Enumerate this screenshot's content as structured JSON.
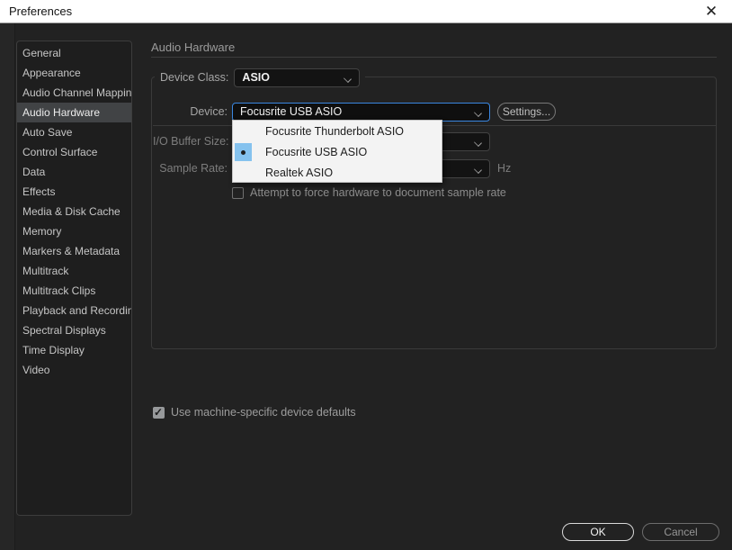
{
  "window": {
    "title": "Preferences",
    "close_glyph": "✕"
  },
  "sidebar": {
    "items": [
      {
        "label": "General",
        "selected": false
      },
      {
        "label": "Appearance",
        "selected": false
      },
      {
        "label": "Audio Channel Mapping",
        "selected": false
      },
      {
        "label": "Audio Hardware",
        "selected": true
      },
      {
        "label": "Auto Save",
        "selected": false
      },
      {
        "label": "Control Surface",
        "selected": false
      },
      {
        "label": "Data",
        "selected": false
      },
      {
        "label": "Effects",
        "selected": false
      },
      {
        "label": "Media & Disk Cache",
        "selected": false
      },
      {
        "label": "Memory",
        "selected": false
      },
      {
        "label": "Markers & Metadata",
        "selected": false
      },
      {
        "label": "Multitrack",
        "selected": false
      },
      {
        "label": "Multitrack Clips",
        "selected": false
      },
      {
        "label": "Playback and Recording",
        "selected": false
      },
      {
        "label": "Spectral Displays",
        "selected": false
      },
      {
        "label": "Time Display",
        "selected": false
      },
      {
        "label": "Video",
        "selected": false
      }
    ]
  },
  "main": {
    "header": "Audio Hardware",
    "device_class": {
      "label": "Device Class:",
      "value": "ASIO"
    },
    "device": {
      "label": "Device:",
      "value": "Focusrite USB ASIO",
      "settings_label": "Settings..."
    },
    "io_buffer": {
      "label": "I/O Buffer Size:",
      "value": ""
    },
    "sample_rate": {
      "label": "Sample Rate:",
      "value": "",
      "unit": "Hz"
    },
    "force_checkbox": {
      "label": "Attempt to force hardware to document sample rate",
      "checked": false
    },
    "machine_defaults_checkbox": {
      "label": "Use machine-specific device defaults",
      "checked": true,
      "check_glyph": "✓"
    }
  },
  "device_dropdown": {
    "options": [
      {
        "label": "Focusrite Thunderbolt ASIO",
        "selected": false
      },
      {
        "label": "Focusrite USB ASIO",
        "selected": true
      },
      {
        "label": "Realtek ASIO",
        "selected": false
      }
    ]
  },
  "footer": {
    "ok_label": "OK",
    "cancel_label": "Cancel"
  },
  "colors": {
    "accent_blue": "#3a86e0",
    "selection_blue": "#85c2ee",
    "titlebar": "#ffffff",
    "background": "#222222"
  }
}
